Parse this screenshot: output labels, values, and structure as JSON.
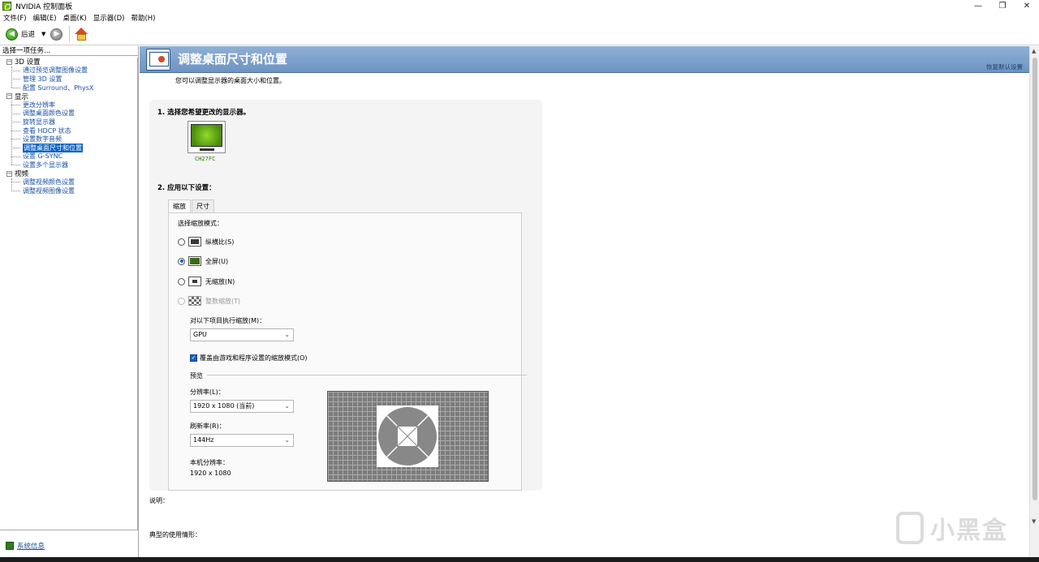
{
  "window": {
    "title": "NVIDIA 控制面板",
    "controls": [
      "—",
      "❐",
      "✕"
    ]
  },
  "menu": [
    "文件(F)",
    "编辑(E)",
    "桌面(K)",
    "显示器(D)",
    "帮助(H)"
  ],
  "toolbar": {
    "back_label": "后退"
  },
  "left": {
    "header": "选择一项任务...",
    "groups": [
      {
        "label": "3D 设置",
        "children": [
          "通过预览调整图像设置",
          "管理 3D 设置",
          "配置 Surround、PhysX"
        ]
      },
      {
        "label": "显示",
        "children": [
          "更改分辨率",
          "调整桌面颜色设置",
          "旋转显示器",
          "查看 HDCP 状态",
          "设置数字音频",
          "调整桌面尺寸和位置",
          "设置 G-SYNC",
          "设置多个显示器"
        ]
      },
      {
        "label": "视频",
        "children": [
          "调整视频颜色设置",
          "调整视频图像设置"
        ]
      }
    ],
    "system_info": "系统信息"
  },
  "main": {
    "title": "调整桌面尺寸和位置",
    "restore": "恢复默认设置",
    "description": "您可以调整显示器的桌面大小和位置。",
    "step1": "1. 选择您希望更改的显示器。",
    "monitor_name": "CH27FC",
    "step2": "2. 应用以下设置：",
    "tabs": [
      "缩放",
      "尺寸"
    ],
    "scaling_mode_label": "选择缩放模式：",
    "modes": [
      {
        "label": "纵横比(S)",
        "checked": false,
        "disabled": false
      },
      {
        "label": "全屏(U)",
        "checked": true,
        "disabled": false
      },
      {
        "label": "无缩放(N)",
        "checked": false,
        "disabled": false
      },
      {
        "label": "整数缩放(T)",
        "checked": false,
        "disabled": true
      }
    ],
    "perform_on_label": "对以下项目执行缩放(M)：",
    "perform_on_value": "GPU",
    "override_label": "覆盖由游戏和程序设置的缩放模式(O)",
    "preview_label": "预览",
    "resolution_label": "分辨率(L)：",
    "resolution_value": "1920 x 1080 (当前)",
    "refresh_label": "刷新率(R)：",
    "refresh_value": "144Hz",
    "native_label": "本机分辨率：",
    "native_value": "1920 x 1080",
    "explain_label": "说明：",
    "typical_label": "典型的使用情形："
  },
  "watermark": "小黑盒"
}
